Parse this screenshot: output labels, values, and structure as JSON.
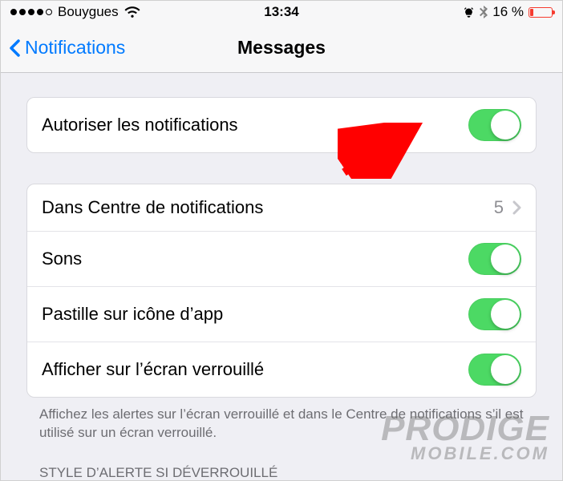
{
  "status": {
    "carrier": "Bouygues",
    "time": "13:34",
    "battery_text": "16 %"
  },
  "nav": {
    "back_label": "Notifications",
    "title": "Messages"
  },
  "rows": {
    "allow_label": "Autoriser les notifications",
    "center_label": "Dans Centre de notifications",
    "center_value": "5",
    "sounds_label": "Sons",
    "badge_label": "Pastille sur icône d’app",
    "lockscreen_label": "Afficher sur l’écran verrouillé"
  },
  "footer": "Affichez les alertes sur l’écran verrouillé et dans le Centre de notifications s’il est utilisé sur un écran verrouillé.",
  "section_header": "STYLE D’ALERTE SI DÉVERROUILLÉ",
  "watermark": {
    "line1": "PRODIGE",
    "line2": "MOBILE.COM"
  }
}
